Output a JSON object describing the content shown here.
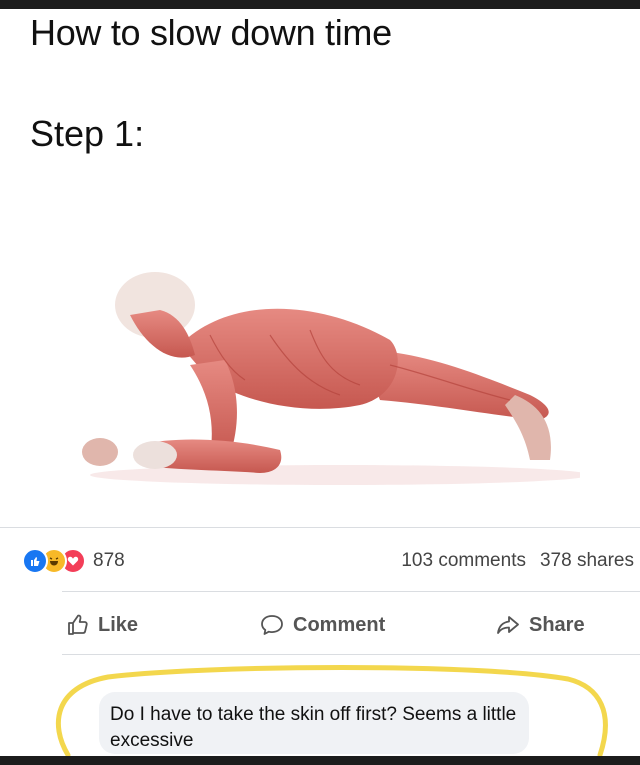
{
  "post": {
    "title": "How to slow down time",
    "step": "Step 1:"
  },
  "illustration": {
    "icon": "anatomy-plank-figure",
    "muscle_color": "#d9726e"
  },
  "reactions": {
    "icons": [
      "like-reaction-icon",
      "haha-reaction-icon",
      "love-reaction-icon"
    ],
    "count": "878"
  },
  "stats": {
    "comments": "103 comments",
    "shares": "378 shares"
  },
  "actions": {
    "like": "Like",
    "comment": "Comment",
    "share": "Share"
  },
  "comment": {
    "text": "Do I have to take the skin off first? Seems a little excessive",
    "highlight_color": "#f2d33a"
  },
  "colors": {
    "like_blue": "#1877f2",
    "haha_yellow": "#f7b928",
    "love_red": "#f33e58",
    "text_gray": "#555555"
  }
}
